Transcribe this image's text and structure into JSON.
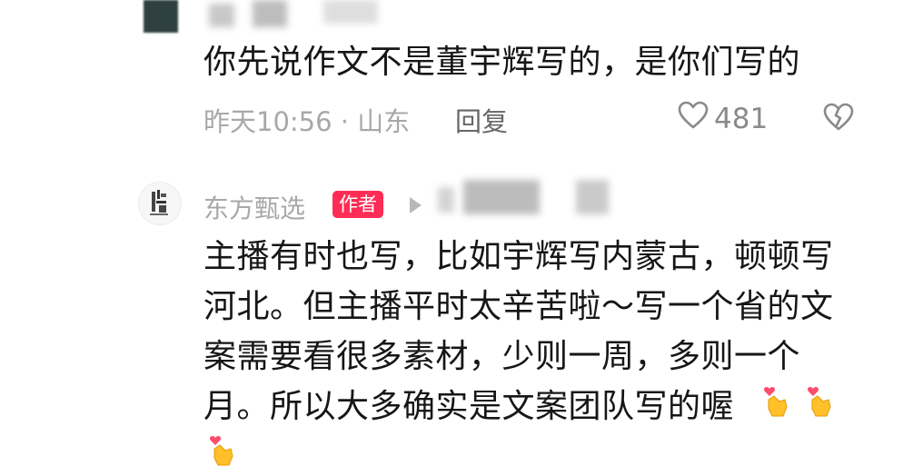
{
  "comment1": {
    "text": "你先说作文不是董宇辉写的，是你们写的",
    "time_location": "昨天10:56 · 山东",
    "reply_label": "回复",
    "like_count": "481",
    "icons": {
      "like": "heart-icon",
      "dislike": "broken-heart-icon"
    }
  },
  "comment2": {
    "author": "东方甄选",
    "badge": "作者",
    "lines": [
      "主播有时也写，比如宇辉写内蒙古，顿顿写",
      "河北。但主播平时太辛苦啦～写一个省的文",
      "案需要看很多素材，少则一周，多则一个",
      "月。所以大多确实是文案团队写的喔"
    ],
    "emoji": "finger-heart-emoji",
    "accent_color": "#ff2c55"
  },
  "colors": {
    "text": "#161616",
    "meta": "#a8a8a8",
    "badge": "#ff2c55"
  }
}
